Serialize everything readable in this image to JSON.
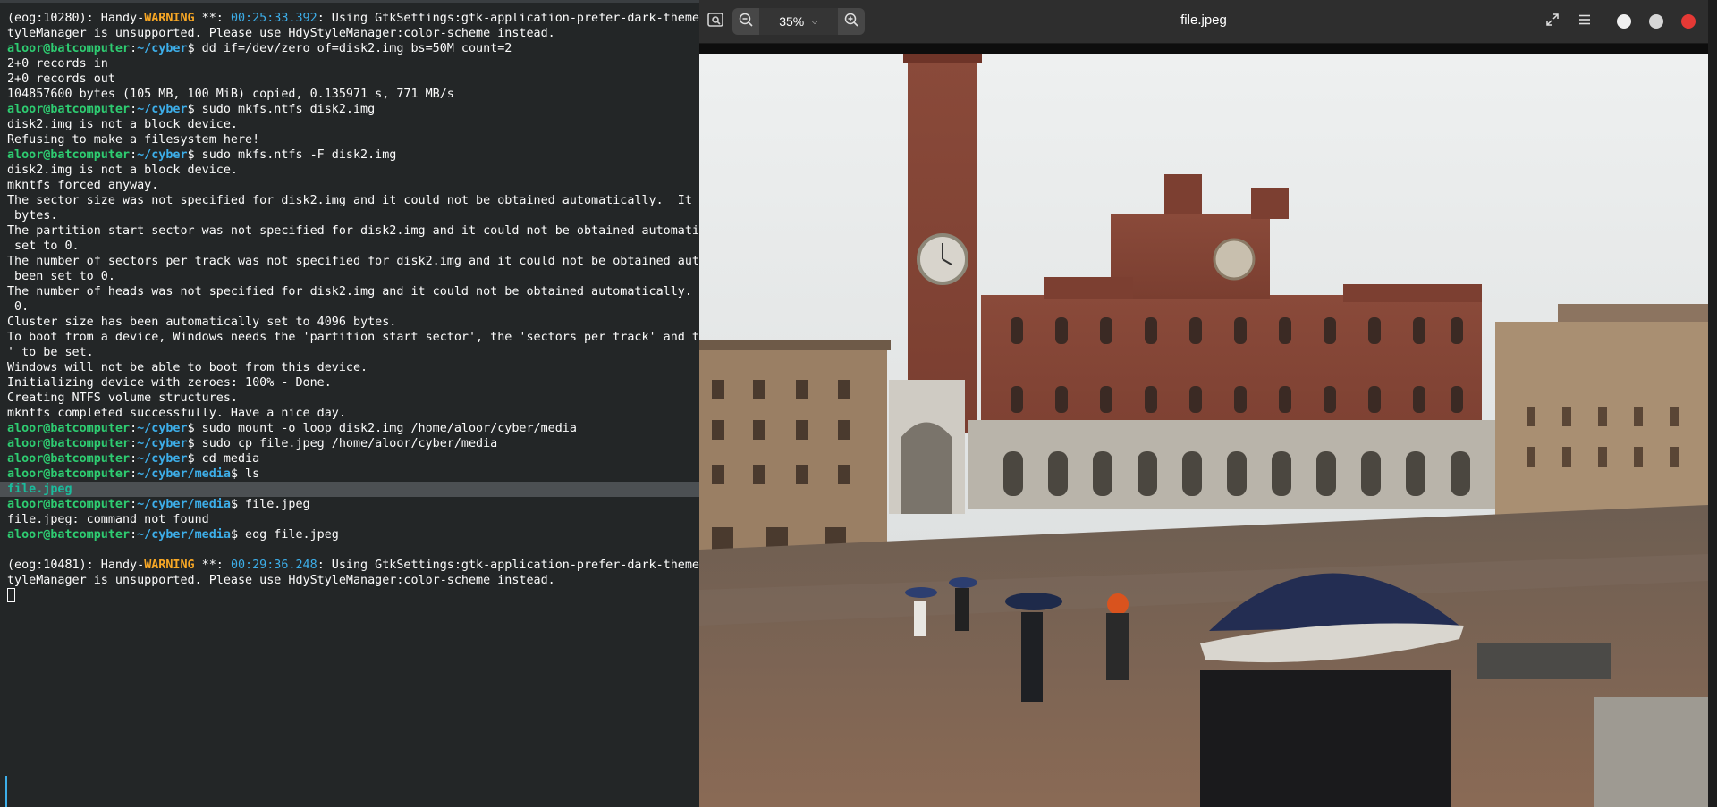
{
  "terminal": {
    "lines": [
      {
        "segments": [
          {
            "t": "(eog:10280): Handy-"
          },
          {
            "t": "WARNING",
            "c": "warn"
          },
          {
            "t": " **: "
          },
          {
            "t": "00:25:33.392",
            "c": "ts"
          },
          {
            "t": ": Using GtkSettings:gtk-application-prefer-dark-theme"
          }
        ]
      },
      {
        "segments": [
          {
            "t": "tyleManager is unsupported. Please use HdyStyleManager:color-scheme instead."
          }
        ]
      },
      {
        "segments": [
          {
            "t": "aloor@batcomputer",
            "c": "user"
          },
          {
            "t": ":"
          },
          {
            "t": "~/cyber",
            "c": "path"
          },
          {
            "t": "$ dd if=/dev/zero of=disk2.img bs=50M count=2"
          }
        ]
      },
      {
        "segments": [
          {
            "t": "2+0 records in"
          }
        ]
      },
      {
        "segments": [
          {
            "t": "2+0 records out"
          }
        ]
      },
      {
        "segments": [
          {
            "t": "104857600 bytes (105 MB, 100 MiB) copied, 0.135971 s, 771 MB/s"
          }
        ]
      },
      {
        "segments": [
          {
            "t": "aloor@batcomputer",
            "c": "user"
          },
          {
            "t": ":"
          },
          {
            "t": "~/cyber",
            "c": "path"
          },
          {
            "t": "$ sudo mkfs.ntfs disk2.img"
          }
        ]
      },
      {
        "segments": [
          {
            "t": "disk2.img is not a block device."
          }
        ]
      },
      {
        "segments": [
          {
            "t": "Refusing to make a filesystem here!"
          }
        ]
      },
      {
        "segments": [
          {
            "t": "aloor@batcomputer",
            "c": "user"
          },
          {
            "t": ":"
          },
          {
            "t": "~/cyber",
            "c": "path"
          },
          {
            "t": "$ sudo mkfs.ntfs -F disk2.img"
          }
        ]
      },
      {
        "segments": [
          {
            "t": "disk2.img is not a block device."
          }
        ]
      },
      {
        "segments": [
          {
            "t": "mkntfs forced anyway."
          }
        ]
      },
      {
        "segments": [
          {
            "t": "The sector size was not specified for disk2.img and it could not be obtained automatically.  It "
          },
          {
            "t": "h",
            "c": "path"
          }
        ]
      },
      {
        "segments": [
          {
            "t": " bytes."
          }
        ]
      },
      {
        "segments": [
          {
            "t": "The partition start sector was not specified for disk2.img and it could not be obtained automatic"
          }
        ]
      },
      {
        "segments": [
          {
            "t": " set to 0."
          }
        ]
      },
      {
        "segments": [
          {
            "t": "The number of sectors per track was not specified for disk2.img and it could not be obtained auto"
          }
        ]
      },
      {
        "segments": [
          {
            "t": " been set to 0."
          }
        ]
      },
      {
        "segments": [
          {
            "t": "The number of heads was not specified for disk2.img and it could not be obtained automatically."
          }
        ]
      },
      {
        "segments": [
          {
            "t": " 0."
          }
        ]
      },
      {
        "segments": [
          {
            "t": "Cluster size has been automatically set to 4096 bytes."
          }
        ]
      },
      {
        "segments": [
          {
            "t": "To boot from a device, Windows needs the 'partition start sector', the 'sectors per track' and th"
          }
        ]
      },
      {
        "segments": [
          {
            "t": "' to be set."
          }
        ]
      },
      {
        "segments": [
          {
            "t": "Windows will not be able to boot from this device."
          }
        ]
      },
      {
        "segments": [
          {
            "t": "Initializing device with zeroes: 100% - Done."
          }
        ]
      },
      {
        "segments": [
          {
            "t": "Creating NTFS volume structures."
          }
        ]
      },
      {
        "segments": [
          {
            "t": "mkntfs completed successfully. Have a nice day."
          }
        ]
      },
      {
        "segments": [
          {
            "t": "aloor@batcomputer",
            "c": "user"
          },
          {
            "t": ":"
          },
          {
            "t": "~/cyber",
            "c": "path"
          },
          {
            "t": "$ sudo mount -o loop disk2.img /home/aloor/cyber/media"
          }
        ]
      },
      {
        "segments": [
          {
            "t": "aloor@batcomputer",
            "c": "user"
          },
          {
            "t": ":"
          },
          {
            "t": "~/cyber",
            "c": "path"
          },
          {
            "t": "$ sudo cp file.jpeg /home/aloor/cyber/media"
          }
        ]
      },
      {
        "segments": [
          {
            "t": "aloor@batcomputer",
            "c": "user"
          },
          {
            "t": ":"
          },
          {
            "t": "~/cyber",
            "c": "path"
          },
          {
            "t": "$ cd media"
          }
        ]
      },
      {
        "segments": [
          {
            "t": "aloor@batcomputer",
            "c": "user"
          },
          {
            "t": ":"
          },
          {
            "t": "~/cyber/media",
            "c": "path"
          },
          {
            "t": "$ ls"
          }
        ]
      },
      {
        "highlight": true,
        "segments": [
          {
            "t": "file.jpeg",
            "c": "file-hl"
          }
        ]
      },
      {
        "segments": [
          {
            "t": "aloor@batcomputer",
            "c": "user"
          },
          {
            "t": ":"
          },
          {
            "t": "~/cyber/media",
            "c": "path"
          },
          {
            "t": "$ file.jpeg"
          }
        ]
      },
      {
        "segments": [
          {
            "t": "file.jpeg: command not found"
          }
        ]
      },
      {
        "segments": [
          {
            "t": "aloor@batcomputer",
            "c": "user"
          },
          {
            "t": ":"
          },
          {
            "t": "~/cyber/media",
            "c": "path"
          },
          {
            "t": "$ eog file.jpeg"
          }
        ]
      },
      {
        "segments": [
          {
            "t": ""
          }
        ]
      },
      {
        "segments": [
          {
            "t": "(eog:10481): Handy-"
          },
          {
            "t": "WARNING",
            "c": "warn"
          },
          {
            "t": " **: "
          },
          {
            "t": "00:29:36.248",
            "c": "ts"
          },
          {
            "t": ": Using GtkSettings:gtk-application-prefer-dark-theme"
          }
        ]
      },
      {
        "segments": [
          {
            "t": "tyleManager is unsupported. Please use HdyStyleManager:color-scheme instead."
          }
        ]
      },
      {
        "cursor": true,
        "segments": []
      }
    ]
  },
  "viewer": {
    "title": "file.jpeg",
    "zoom": "35%",
    "icons": {
      "gallery": "gallery-icon",
      "zoom_out": "zoom-out-icon",
      "zoom_in": "zoom-in-icon",
      "fullscreen": "fullscreen-icon",
      "menu": "hamburger-menu-icon"
    },
    "window_buttons": [
      "minimize",
      "maximize",
      "close"
    ],
    "colors": {
      "close": "#e53935",
      "header": "#2e2e2e"
    }
  }
}
